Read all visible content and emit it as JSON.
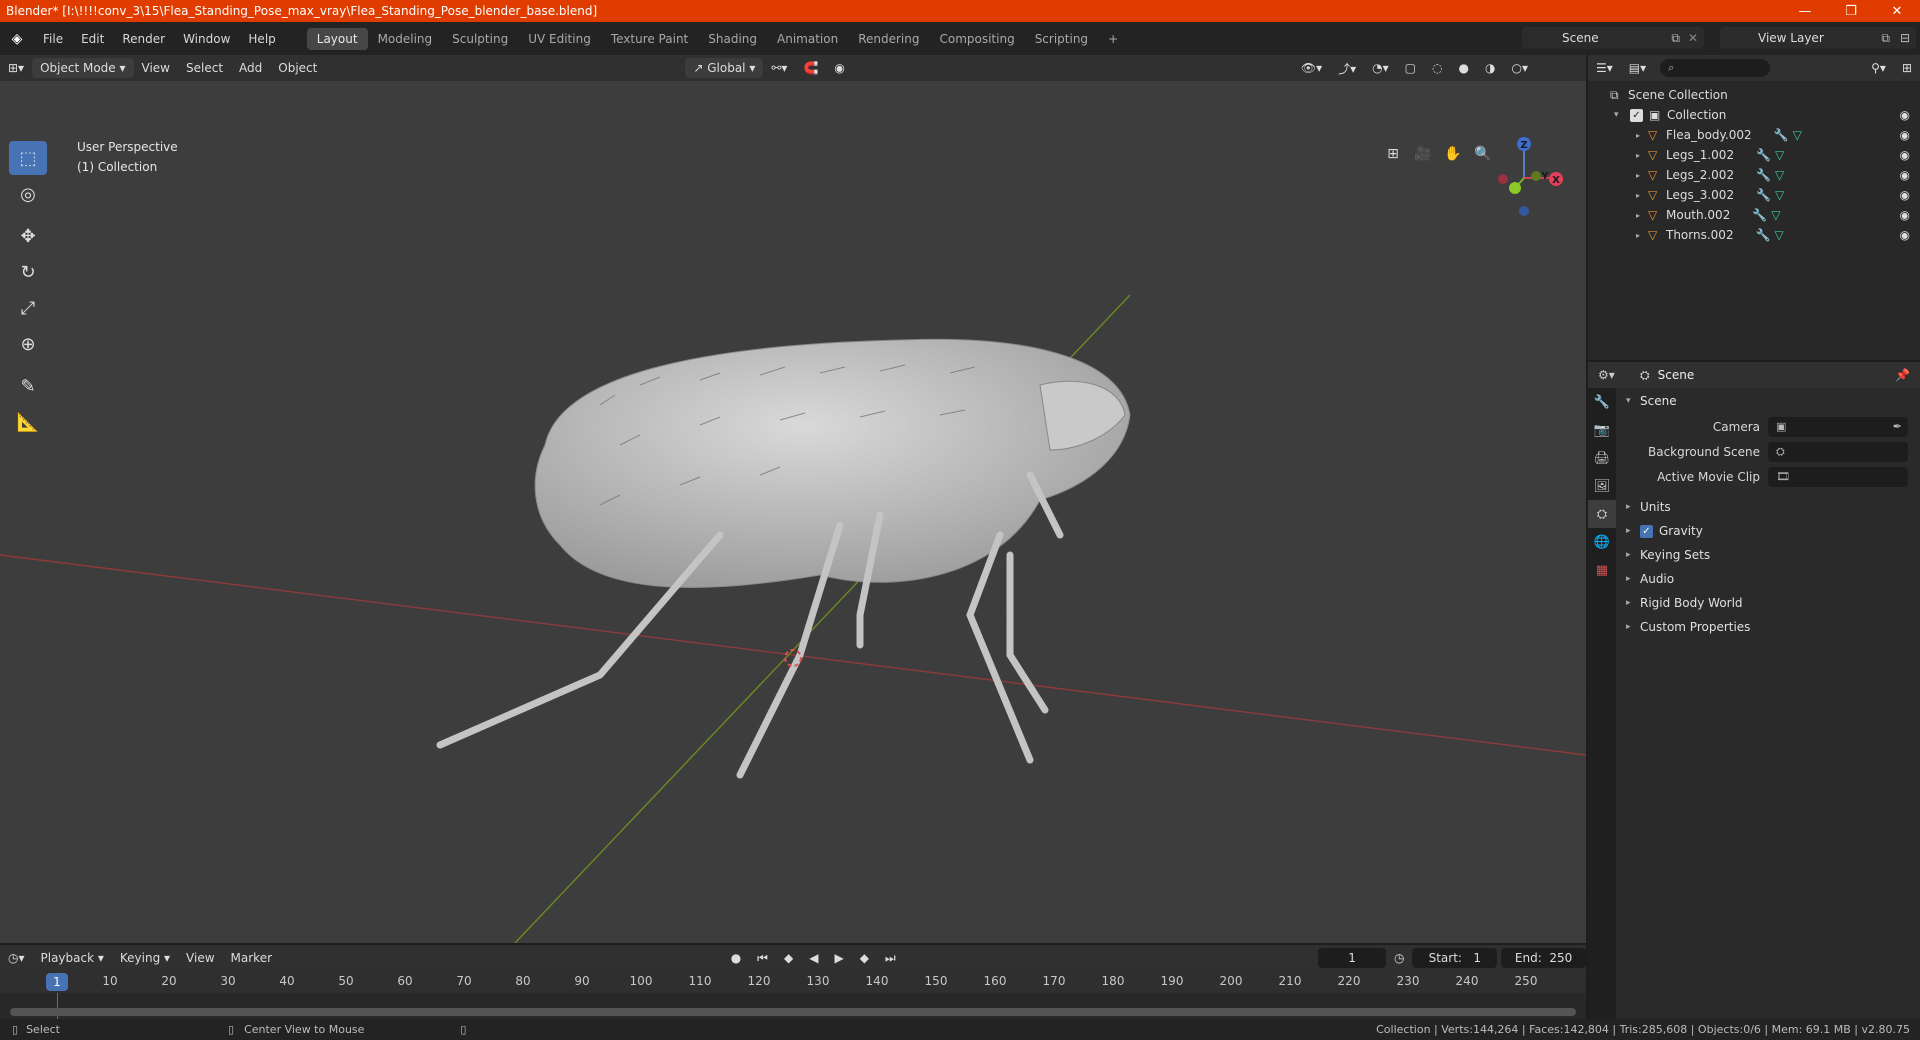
{
  "window": {
    "title": "Blender* [I:\\!!!!conv_3\\15\\Flea_Standing_Pose_max_vray\\Flea_Standing_Pose_blender_base.blend]",
    "minimize": "—",
    "maximize": "❐",
    "close": "✕"
  },
  "menu": [
    "File",
    "Edit",
    "Render",
    "Window",
    "Help"
  ],
  "workspaces": [
    "Layout",
    "Modeling",
    "Sculpting",
    "UV Editing",
    "Texture Paint",
    "Shading",
    "Animation",
    "Rendering",
    "Compositing",
    "Scripting"
  ],
  "active_workspace": "Layout",
  "scene_name": "Scene",
  "view_layer": "View Layer",
  "viewport": {
    "mode": "Object Mode",
    "menus": [
      "View",
      "Select",
      "Add",
      "Object"
    ],
    "orientation": "Global",
    "perspective_label": "User Perspective",
    "collection_label": "(1) Collection",
    "axes": {
      "x": "X",
      "y": "Y",
      "z": "Z"
    }
  },
  "outliner": {
    "root": "Scene Collection",
    "collection": "Collection",
    "objects": [
      "Flea_body.002",
      "Legs_1.002",
      "Legs_2.002",
      "Legs_3.002",
      "Mouth.002",
      "Thorns.002"
    ]
  },
  "properties": {
    "header": "Scene",
    "section": "Scene",
    "fields": [
      {
        "label": "Camera",
        "value": ""
      },
      {
        "label": "Background Scene",
        "value": ""
      },
      {
        "label": "Active Movie Clip",
        "value": ""
      }
    ],
    "subpanels": [
      "Units",
      "Gravity",
      "Keying Sets",
      "Audio",
      "Rigid Body World",
      "Custom Properties"
    ],
    "gravity_checked": true
  },
  "timeline": {
    "menus": [
      "Playback",
      "Keying",
      "View",
      "Marker"
    ],
    "current_frame": "1",
    "start_label": "Start:",
    "start": "1",
    "end_label": "End:",
    "end": "250",
    "ticks": [
      "1",
      "10",
      "20",
      "30",
      "40",
      "50",
      "60",
      "70",
      "80",
      "90",
      "100",
      "110",
      "120",
      "130",
      "140",
      "150",
      "160",
      "170",
      "180",
      "190",
      "200",
      "210",
      "220",
      "230",
      "240",
      "250"
    ]
  },
  "status": {
    "left1": "Select",
    "left2": "Center View to Mouse",
    "right": "Collection | Verts:144,264 | Faces:142,804 | Tris:285,608 | Objects:0/6 | Mem: 69.1 MB | v2.80.75"
  },
  "colors": {
    "title_bar": "#e03c00",
    "accent": "#4772b3",
    "object_icon": "#e8913a",
    "mesh_icon": "#3fc79a"
  }
}
